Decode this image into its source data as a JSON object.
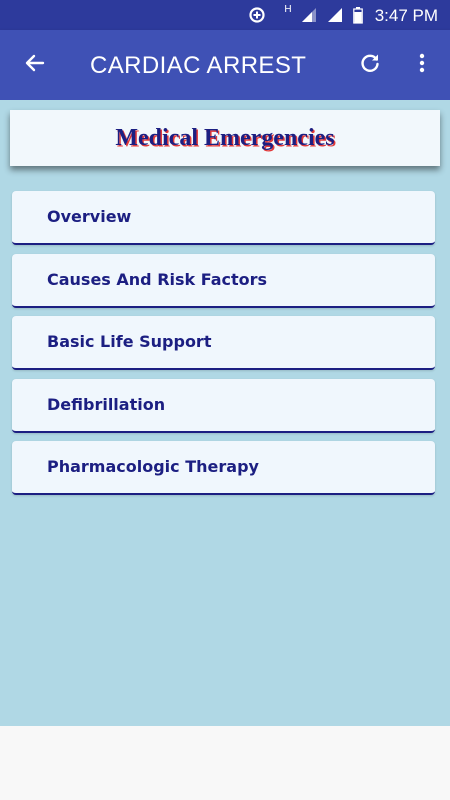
{
  "status_bar": {
    "time": "3:47 PM",
    "network_letter": "H",
    "icons": [
      "data-saver-icon",
      "network-type-icon",
      "signal-icon",
      "signal-icon-2",
      "battery-icon"
    ]
  },
  "app_bar": {
    "title": "CARDIAC ARREST",
    "back_icon": "arrow-back-icon",
    "refresh_icon": "refresh-icon",
    "menu_icon": "more-vert-icon",
    "color": "#3f51b5",
    "status_color": "#2d3a9c"
  },
  "header": {
    "title": "Medical Emergencies"
  },
  "menu": {
    "items": [
      {
        "label": "Overview"
      },
      {
        "label": "Causes And Risk Factors"
      },
      {
        "label": "Basic Life Support"
      },
      {
        "label": "Defibrillation"
      },
      {
        "label": "Pharmacologic Therapy"
      }
    ]
  },
  "colors": {
    "content_background": "#b0d8e5",
    "item_background": "#f0f7fd",
    "item_text": "#1c1f82",
    "title_shadow": "#e23a3a"
  }
}
